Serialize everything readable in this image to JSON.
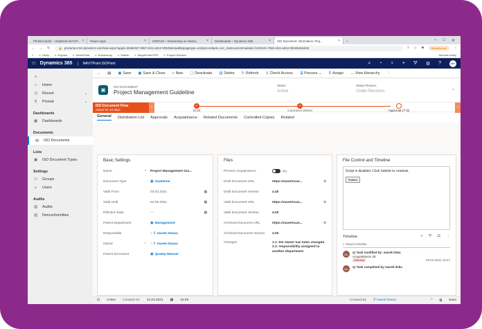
{
  "browser": {
    "tabs": [
      {
        "label": "Přehled úkolů – HelpDesk (NAVIT..."
      },
      {
        "label": "Power Apps"
      },
      {
        "label": "ISOPoint – Dokumenty ve sledov..."
      },
      {
        "label": "Dashboards – Dynamics 365"
      },
      {
        "label": "ISO Document: Information: Proj..."
      }
    ],
    "url": "prozanta.crm4.dynamics.com/main.aspx?appid=30d6c557-0967-eb11-a812-000d3ab4aa9b&pagetype=entityrecord&etn=nvc_isodocumentmain&id=f1d31521-7682-eb11-a812-000d3ab4dc62",
    "extension_label": "Aktualizovat",
    "bookmarks": [
      "Úkoly",
      "Kryptos",
      "SharePoint",
      "Dokumenty",
      "Sobisk",
      "MegaPortal.ERP",
      "Project.Solution"
    ],
    "other_bookmarks": "Seznam četby"
  },
  "appbar": {
    "app_name": "Dynamics 365",
    "app_title": "NAVITPoint ISOPoint",
    "avatar_initials": "MH"
  },
  "sidebar": {
    "top": [
      {
        "label": "Home",
        "icon": "home-icon"
      },
      {
        "label": "Recent",
        "icon": "clock-icon"
      },
      {
        "label": "Pinned",
        "icon": "pin-icon"
      }
    ],
    "sections": [
      {
        "title": "Dashboards",
        "items": [
          "Dashboards"
        ]
      },
      {
        "title": "Documents",
        "items": [
          "ISO Documents"
        ]
      },
      {
        "title": "Lists",
        "items": [
          "ISO Document Types"
        ]
      },
      {
        "title": "Settings",
        "items": [
          "Groups",
          "Users"
        ]
      },
      {
        "title": "Audits",
        "items": [
          "Audits",
          "Nonconformities"
        ]
      }
    ]
  },
  "commands": [
    "Save",
    "Save & Close",
    "New",
    "Deactivate",
    "Delete",
    "Refresh",
    "Check Access",
    "Process",
    "Assign",
    "View Hierarchy"
  ],
  "record": {
    "type": "ISO DOCUMENT",
    "name": "Project Management Guideline",
    "status_label": "Status",
    "status_value": "Active",
    "status_reason_label": "Status Reason",
    "status_reason_value": "Under Revision"
  },
  "process": {
    "title": "ISO Document Flow",
    "subtitle": "Active for 43 days",
    "stages": [
      "Draft",
      "Comment Wheel",
      "Approval (7 D)"
    ]
  },
  "form_tabs": [
    "General",
    "Distribution List",
    "Approvals",
    "Acquaintance",
    "Related Documents",
    "Controlled Copies",
    "Related"
  ],
  "basic": {
    "title": "Basic Settings",
    "rows": [
      {
        "label": "Name",
        "value": "Project Management Gui...",
        "required": "*"
      },
      {
        "label": "Document Type",
        "value": "Guideline"
      },
      {
        "label": "Valid From",
        "value": "03.03.2021"
      },
      {
        "label": "Valid Until",
        "value": "04.06.2021"
      },
      {
        "label": "Effective Date",
        "value": "---"
      },
      {
        "label": "Parent Department",
        "value": "Management"
      },
      {
        "label": "Responsible",
        "value": "marek hlavac"
      },
      {
        "label": "Owner",
        "value": "marek hlavac",
        "required": "*"
      },
      {
        "label": "Parent Document",
        "value": "Quality Manual"
      }
    ]
  },
  "files": {
    "title": "Files",
    "prevent_label": "Prevent Acquaintance",
    "prevent_value": "No",
    "rows": [
      {
        "label": "Draft Document URL",
        "value": "https://naverticas..."
      },
      {
        "label": "Draft Document Version",
        "value": "4.40"
      },
      {
        "label": "Valid Document URL",
        "value": "https://naverticas..."
      },
      {
        "label": "Valid Document Version",
        "value": "4.00"
      },
      {
        "label": "Archived Document URL",
        "value": "https://naverticas..."
      },
      {
        "label": "Archived Document Version",
        "value": "2.00"
      }
    ],
    "changes_label": "Changes",
    "changes_value": "1.1. the owner has been changed 2.3. responsibility assigned to another department"
  },
  "control": {
    "title": "File Control and Timeline",
    "script_message": "Script is disabled. Click Submit to continue.",
    "submit_label": "Submit",
    "timeline_title": "Timeline",
    "search_placeholder": "Search timeline",
    "items": [
      {
        "initials": "ML",
        "text": "Task modified by: marek linka",
        "sub": "Acquaintance 28",
        "badge": "Overdue",
        "date": "29.04.2021 13:47"
      },
      {
        "initials": "ML",
        "text": "Task completed by marek linka",
        "sub": "",
        "badge": "",
        "date": ""
      }
    ]
  },
  "statusbar": {
    "status": "Active",
    "created_on_label": "Created On",
    "created_on_value": "11.03.2021",
    "time": "15:29",
    "created_by_label": "Created By",
    "created_by_value": "marek hlavac",
    "save_label": "Save"
  }
}
